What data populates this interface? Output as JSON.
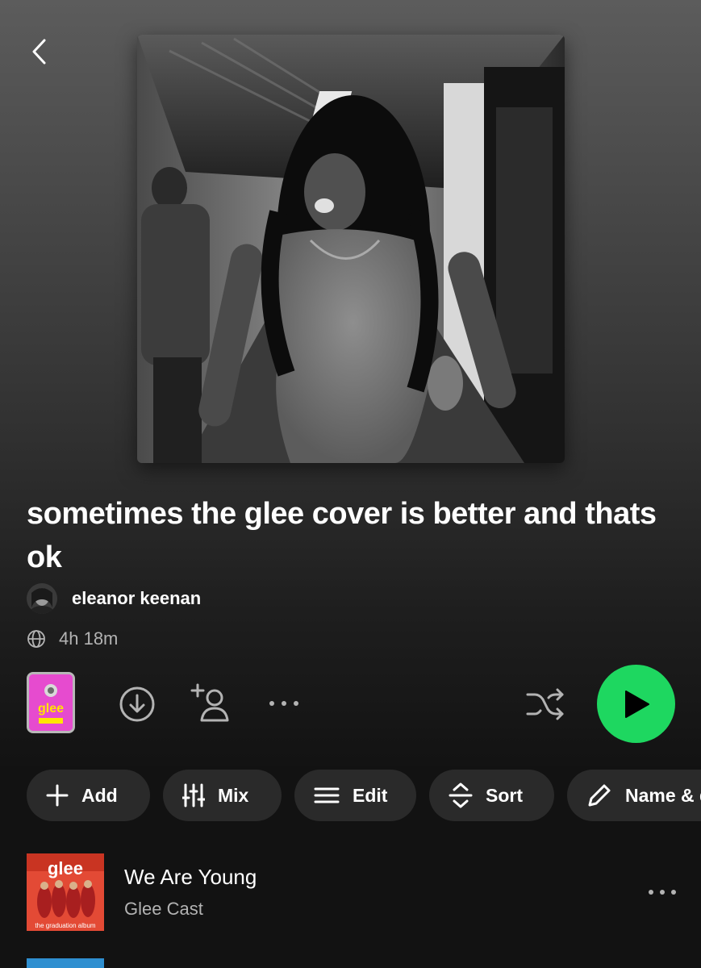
{
  "playlist": {
    "title": "sometimes the glee cover is better and thats ok",
    "owner": "eleanor keenan",
    "duration": "4h 18m",
    "visibility_icon": "globe-icon"
  },
  "nav": {
    "back_icon": "chevron-left-icon"
  },
  "actions": {
    "mini_cover_text": "glee",
    "download_icon": "download-circle-icon",
    "add_user_icon": "add-user-icon",
    "more_icon": "more-horizontal-icon",
    "shuffle_icon": "shuffle-icon",
    "play_icon": "play-icon"
  },
  "chips": [
    {
      "label": "Add",
      "icon": "plus-icon"
    },
    {
      "label": "Mix",
      "icon": "sliders-icon"
    },
    {
      "label": "Edit",
      "icon": "list-icon"
    },
    {
      "label": "Sort",
      "icon": "sort-icon"
    },
    {
      "label": "Name & d",
      "icon": "pencil-icon"
    }
  ],
  "tracks": [
    {
      "title": "We Are Young",
      "artist": "Glee Cast",
      "art_text": "glee",
      "art_subtext": "the graduation album"
    }
  ],
  "colors": {
    "accent": "#1ed760",
    "chip_bg": "#2a2a2a",
    "secondary_text": "#b3b3b3"
  }
}
